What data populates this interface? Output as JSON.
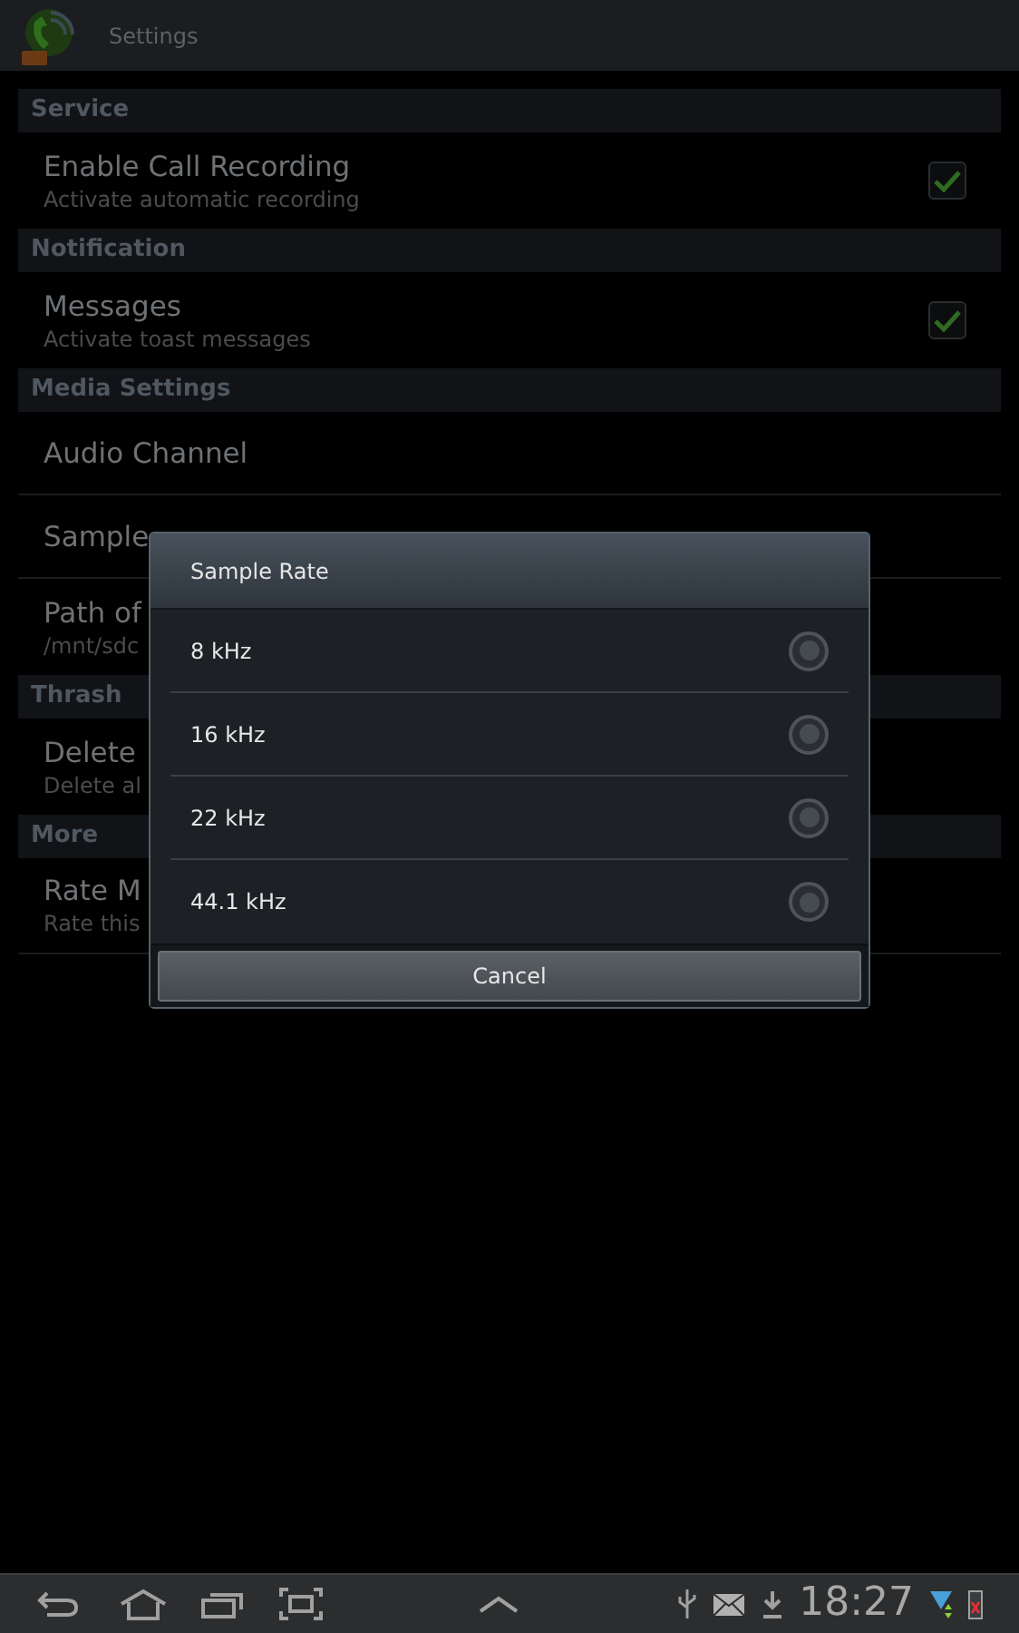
{
  "app_bar": {
    "title": "Settings"
  },
  "sections": [
    {
      "title": "Service",
      "items": [
        {
          "kind": "checkbox",
          "title": "Enable Call Recording",
          "summary": "Activate automatic recording",
          "checked": true
        }
      ]
    },
    {
      "title": "Notification",
      "items": [
        {
          "kind": "checkbox",
          "title": "Messages",
          "summary": "Activate toast messages",
          "checked": true
        }
      ]
    },
    {
      "title": "Media Settings",
      "items": [
        {
          "kind": "plain",
          "title": "Audio Channel"
        },
        {
          "kind": "plain",
          "title": "Sample"
        },
        {
          "kind": "plain",
          "title": "Path of",
          "summary": "/mnt/sdc"
        }
      ]
    },
    {
      "title": "Thrash",
      "items": [
        {
          "kind": "plain",
          "title": "Delete",
          "summary": "Delete al"
        }
      ]
    },
    {
      "title": "More",
      "items": [
        {
          "kind": "plain",
          "title": "Rate M",
          "summary": "Rate this"
        }
      ]
    }
  ],
  "dialog": {
    "title": "Sample Rate",
    "options": [
      {
        "label": "8 kHz",
        "selected": false
      },
      {
        "label": "16 kHz",
        "selected": false
      },
      {
        "label": "22 kHz",
        "selected": false
      },
      {
        "label": "44.1 kHz",
        "selected": false
      }
    ],
    "cancel": "Cancel"
  },
  "nav_bar": {
    "time": "18:27"
  }
}
